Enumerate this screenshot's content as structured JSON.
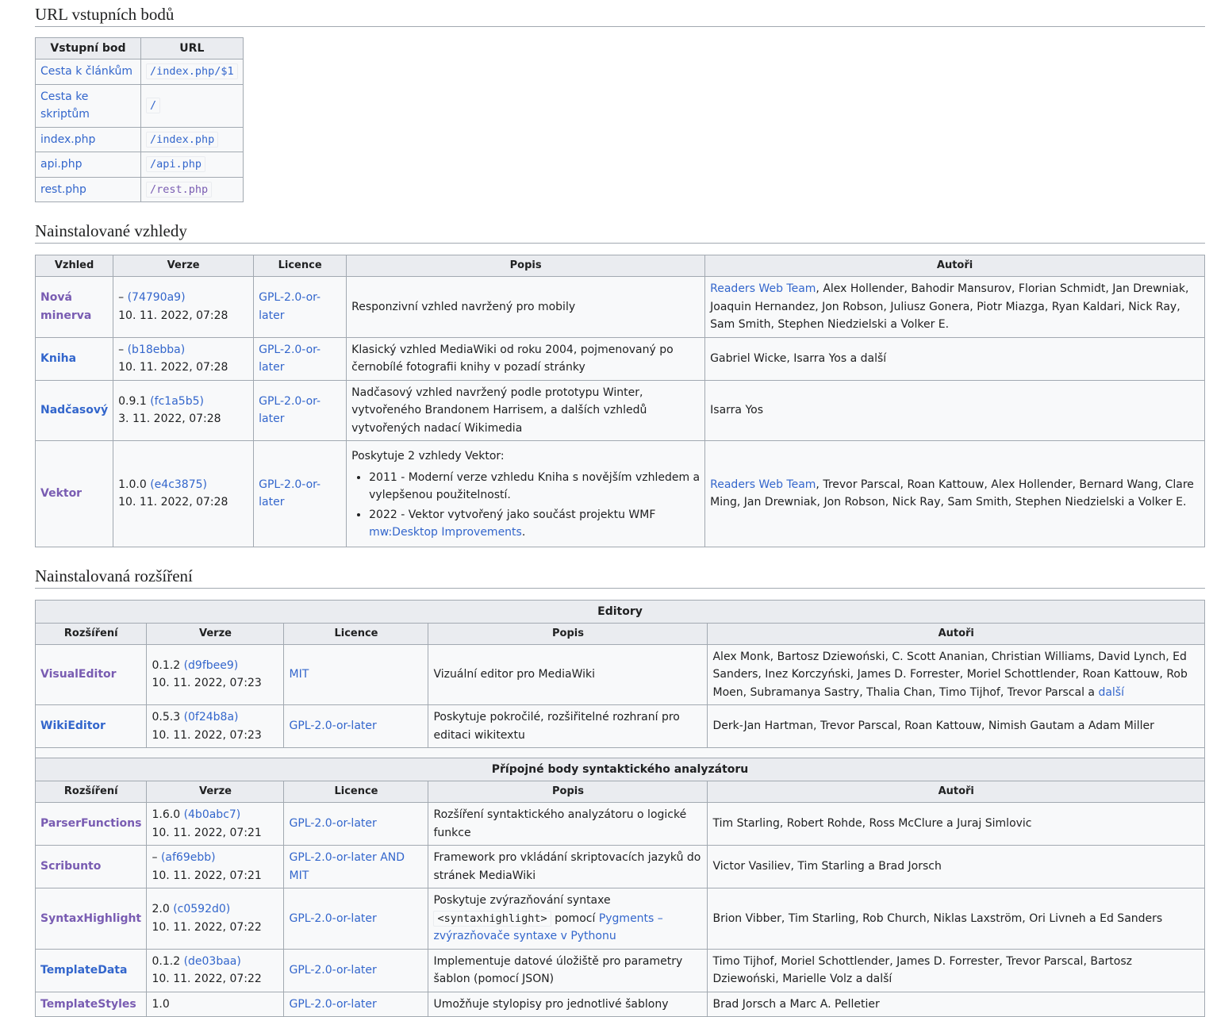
{
  "entry": {
    "heading": "URL vstupních bodů",
    "col_entry": "Vstupní bod",
    "col_url": "URL",
    "rows": [
      {
        "name": "Cesta k článkům",
        "url": "/index.php/$1"
      },
      {
        "name": "Cesta ke skriptům",
        "url": "/"
      },
      {
        "name": "index.php",
        "url": "/index.php"
      },
      {
        "name": "api.php",
        "url": "/api.php"
      },
      {
        "name": "rest.php",
        "url": "/rest.php"
      }
    ]
  },
  "skins": {
    "heading": "Nainstalované vzhledy",
    "cols": [
      "Vzhled",
      "Verze",
      "Licence",
      "Popis",
      "Autoři"
    ],
    "rows": [
      {
        "name": "Nová minerva",
        "ver_prefix": "–",
        "hash": "(74790a9)",
        "date": "10. 11. 2022, 07:28",
        "license": "GPL-2.0-or-later",
        "desc": "Responzivní vzhled navržený pro mobily",
        "authors_link": "Readers Web Team",
        "authors": ", Alex Hollender, Bahodir Mansurov, Florian Schmidt, Jan Drewniak, Joaquin Hernandez, Jon Robson, Juliusz Gonera, Piotr Miazga, Ryan Kaldari, Nick Ray, Sam Smith, Stephen Niedzielski a Volker E."
      },
      {
        "name": "Kniha",
        "ver_prefix": "–",
        "hash": "(b18ebba)",
        "date": "10. 11. 2022, 07:28",
        "license": "GPL-2.0-or-later",
        "desc": "Klasický vzhled MediaWiki od roku 2004, pojmenovaný po černobílé fotografii knihy v pozadí stránky",
        "authors_link": "",
        "authors": "Gabriel Wicke, Isarra Yos a další"
      },
      {
        "name": "Nadčasový",
        "ver_prefix": "0.9.1",
        "hash": "(fc1a5b5)",
        "date": "3. 11. 2022, 07:28",
        "license": "GPL-2.0-or-later",
        "desc": "Nadčasový vzhled navržený podle prototypu Winter, vytvořeného Brandonem Harrisem, a dalších vzhledů vytvořených nadací Wikimedia",
        "authors_link": "",
        "authors": "Isarra Yos"
      }
    ],
    "vector": {
      "name": "Vektor",
      "ver_prefix": "1.0.0",
      "hash": "(e4c3875)",
      "date": "10. 11. 2022, 07:28",
      "license": "GPL-2.0-or-later",
      "desc_intro": "Poskytuje 2 vzhledy Vektor:",
      "bullet1": "2011 - Moderní verze vzhledu Kniha s novějším vzhledem a vylepšenou použitelností.",
      "bullet2_text": "2022 - Vektor vytvořený jako součást projektu WMF ",
      "bullet2_link": "mw:Desktop Improvements",
      "bullet2_end": ".",
      "authors_link": "Readers Web Team",
      "authors": ", Trevor Parscal, Roan Kattouw, Alex Hollender, Bernard Wang, Clare Ming, Jan Drewniak, Jon Robson, Nick Ray, Sam Smith, Stephen Niedzielski a Volker E."
    }
  },
  "ext": {
    "heading": "Nainstalovaná rozšíření",
    "cols": [
      "Rozšíření",
      "Verze",
      "Licence",
      "Popis",
      "Autoři"
    ],
    "group1": "Editory",
    "group2": "Přípojné body syntaktického analyzátoru",
    "ve": {
      "name": "VisualEditor",
      "ver_prefix": "0.1.2",
      "hash": "(d9fbee9)",
      "date": "10. 11. 2022, 07:23",
      "license": "MIT",
      "desc": "Vizuální editor pro MediaWiki",
      "authors": "Alex Monk, Bartosz Dziewoński, C. Scott Ananian, Christian Williams, David Lynch, Ed Sanders, Inez Korczyński, James D. Forrester, Moriel Schottlender, Roan Kattouw, Rob Moen, Subramanya Sastry, Thalia Chan, Timo Tijhof, Trevor Parscal a ",
      "authors_link": "další"
    },
    "we": {
      "name": "WikiEditor",
      "ver_prefix": "0.5.3",
      "hash": "(0f24b8a)",
      "date": "10. 11. 2022, 07:23",
      "license": "GPL-2.0-or-later",
      "desc": "Poskytuje pokročilé, rozšiřitelné rozhraní pro editaci wikitextu",
      "authors": "Derk-Jan Hartman, Trevor Parscal, Roan Kattouw, Nimish Gautam a Adam Miller"
    },
    "pf": {
      "name": "ParserFunctions",
      "ver_prefix": "1.6.0",
      "hash": "(4b0abc7)",
      "date": "10. 11. 2022, 07:21",
      "license": "GPL-2.0-or-later",
      "desc": "Rozšíření syntaktického analyzátoru o logické funkce",
      "authors": "Tim Starling, Robert Rohde, Ross McClure a Juraj Simlovic"
    },
    "sc": {
      "name": "Scribunto",
      "ver_prefix": "–",
      "hash": "(af69ebb)",
      "date": "10. 11. 2022, 07:21",
      "license": "GPL-2.0-or-later AND MIT",
      "desc": "Framework pro vkládání skriptovacích jazyků do stránek MediaWiki",
      "authors": "Victor Vasiliev, Tim Starling a Brad Jorsch"
    },
    "sh": {
      "name": "SyntaxHighlight",
      "ver_prefix": "2.0",
      "hash": "(c0592d0)",
      "date": "10. 11. 2022, 07:22",
      "license": "GPL-2.0-or-later",
      "desc_a": "Poskytuje zvýrazňování syntaxe ",
      "desc_code": "<syntaxhighlight>",
      "desc_b": " pomocí ",
      "desc_link": "Pygments – zvýrazňovače syntaxe v Pythonu",
      "authors": "Brion Vibber, Tim Starling, Rob Church, Niklas Laxström, Ori Livneh a Ed Sanders"
    },
    "td": {
      "name": "TemplateData",
      "ver_prefix": "0.1.2",
      "hash": "(de03baa)",
      "date": "10. 11. 2022, 07:22",
      "license": "GPL-2.0-or-later",
      "desc": "Implementuje datové úložiště pro parametry šablon (pomocí JSON)",
      "authors": "Timo Tijhof, Moriel Schottlender, James D. Forrester, Trevor Parscal, Bartosz Dziewoński, Marielle Volz a další"
    },
    "ts": {
      "name": "TemplateStyles",
      "ver_prefix": "1.0",
      "license": "GPL-2.0-or-later",
      "desc": "Umožňuje stylopisy pro jednotlivé šablony",
      "authors": "Brad Jorsch a Marc A. Pelletier"
    }
  },
  "colors": {
    "link": "#3366cc",
    "visited": "#795cb2",
    "border": "#a2a9b1",
    "header_bg": "#eaecf0",
    "cell_bg": "#f8f9fa"
  }
}
